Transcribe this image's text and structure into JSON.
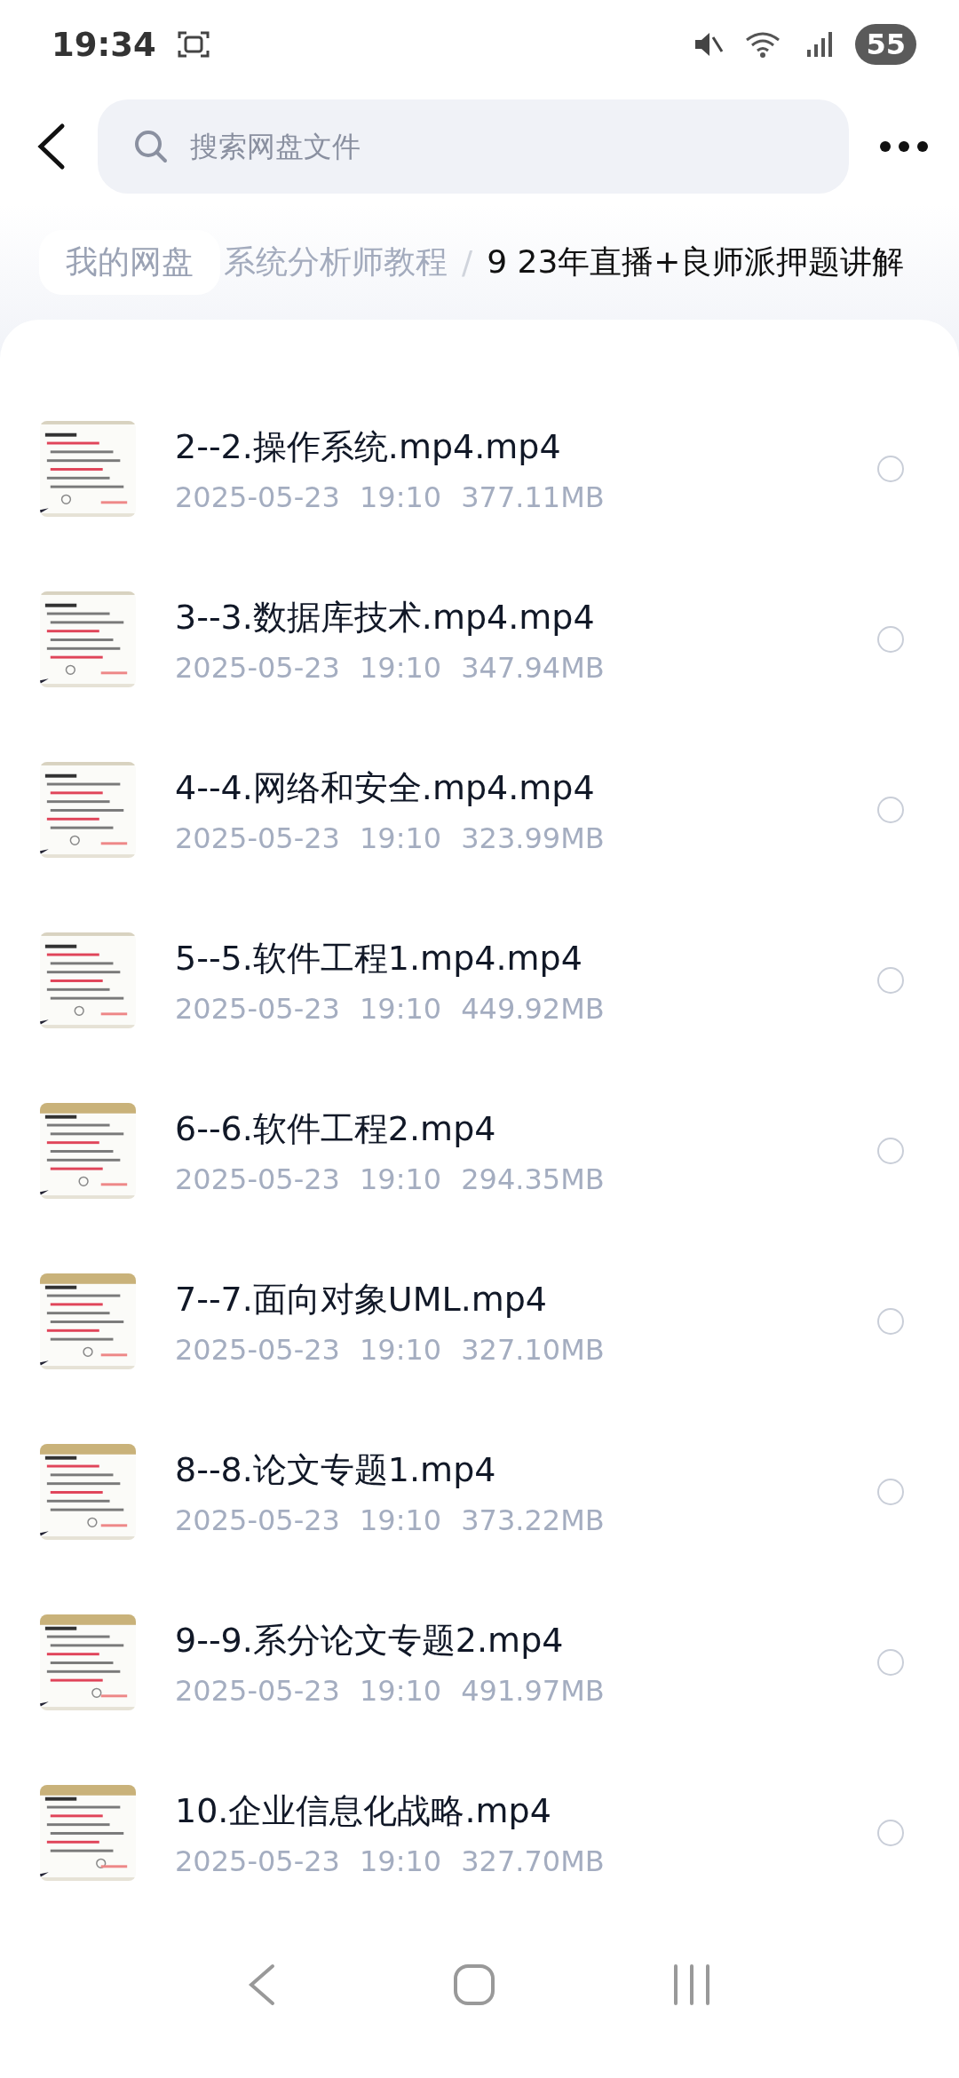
{
  "status_bar": {
    "time": "19:34",
    "battery": "55"
  },
  "search": {
    "placeholder": "搜索网盘文件"
  },
  "breadcrumb": [
    {
      "label": "我的网盘",
      "kind": "root"
    },
    {
      "label": "系统分析师教程",
      "kind": "folder"
    },
    {
      "label": "9 23年直播+良师派押题讲解",
      "kind": "current",
      "separator": "/"
    }
  ],
  "files": [
    {
      "name": "2--2.操作系统.mp4.mp4",
      "date": "2025-05-23",
      "time": "19:10",
      "size": "377.11MB",
      "selected": false
    },
    {
      "name": "3--3.数据库技术.mp4.mp4",
      "date": "2025-05-23",
      "time": "19:10",
      "size": "347.94MB",
      "selected": false
    },
    {
      "name": "4--4.网络和安全.mp4.mp4",
      "date": "2025-05-23",
      "time": "19:10",
      "size": "323.99MB",
      "selected": false
    },
    {
      "name": "5--5.软件工程1.mp4.mp4",
      "date": "2025-05-23",
      "time": "19:10",
      "size": "449.92MB",
      "selected": false
    },
    {
      "name": "6--6.软件工程2.mp4",
      "date": "2025-05-23",
      "time": "19:10",
      "size": "294.35MB",
      "selected": false
    },
    {
      "name": "7--7.面向对象UML.mp4",
      "date": "2025-05-23",
      "time": "19:10",
      "size": "327.10MB",
      "selected": false
    },
    {
      "name": "8--8.论文专题1.mp4",
      "date": "2025-05-23",
      "time": "19:10",
      "size": "373.22MB",
      "selected": false
    },
    {
      "name": "9--9.系分论文专题2.mp4",
      "date": "2025-05-23",
      "time": "19:10",
      "size": "491.97MB",
      "selected": false
    },
    {
      "name": "10.企业信息化战略.mp4",
      "date": "2025-05-23",
      "time": "19:10",
      "size": "327.70MB",
      "selected": false
    }
  ]
}
